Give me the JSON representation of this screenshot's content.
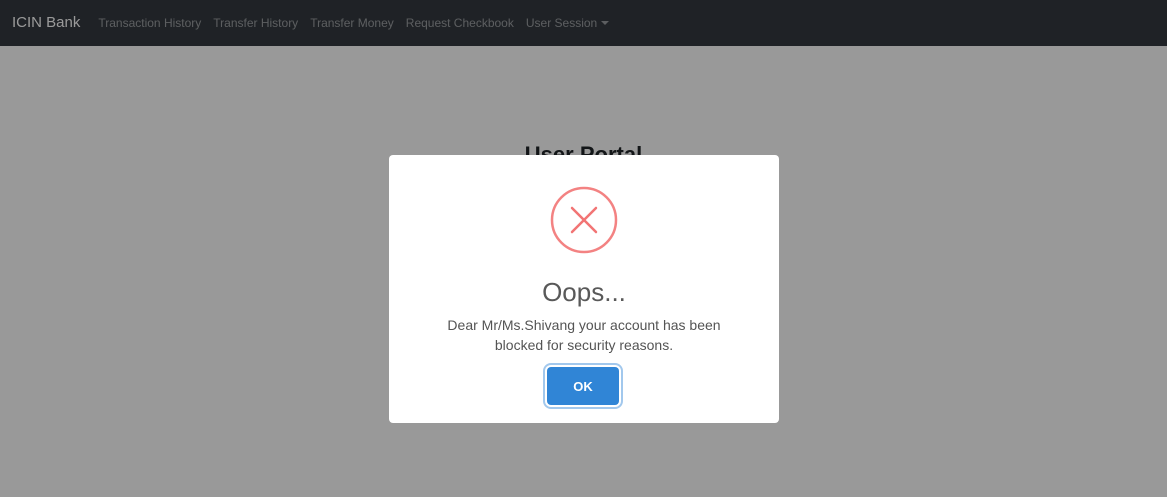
{
  "navbar": {
    "brand": "ICIN Bank",
    "links": [
      {
        "label": "Transaction History"
      },
      {
        "label": "Transfer History"
      },
      {
        "label": "Transfer Money"
      },
      {
        "label": "Request Checkbook"
      },
      {
        "label": "User Session",
        "dropdown": true
      }
    ]
  },
  "main": {
    "heading": "User Portal"
  },
  "modal": {
    "icon": "error-x-icon",
    "icon_color": "#f27474",
    "title": "Oops...",
    "message": "Dear Mr/Ms.Shivang your account has been blocked for security reasons.",
    "ok_label": "OK",
    "ok_color": "#3085d6"
  },
  "colors": {
    "navbar_bg": "#343a40",
    "overlay": "rgba(0,0,0,0.4)"
  }
}
